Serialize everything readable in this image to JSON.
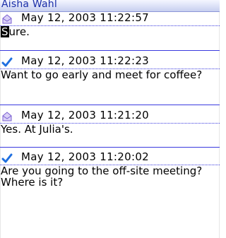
{
  "header": {
    "title": "Aisha Wahl"
  },
  "messages": [
    {
      "icon": "opened-envelope-icon",
      "timestamp": "May 12, 2003 11:22:57",
      "body_cursor_char": "S",
      "body_rest": "ure."
    },
    {
      "icon": "sent-check-icon",
      "timestamp": "May 12, 2003 11:22:23",
      "body": "Want to go early and meet for coffee?"
    },
    {
      "icon": "opened-envelope-icon",
      "timestamp": "May 12, 2003 11:21:20",
      "body": "Yes. At Julia's."
    },
    {
      "icon": "sent-check-icon",
      "timestamp": "May 12, 2003 11:20:02",
      "body": "Are you going to the off-site meeting? Where is it?"
    }
  ],
  "colors": {
    "header_text": "#1b2fa8",
    "separator": "#3a3adf",
    "check": "#1f6fe0",
    "envelope": "#8b6fd6"
  }
}
